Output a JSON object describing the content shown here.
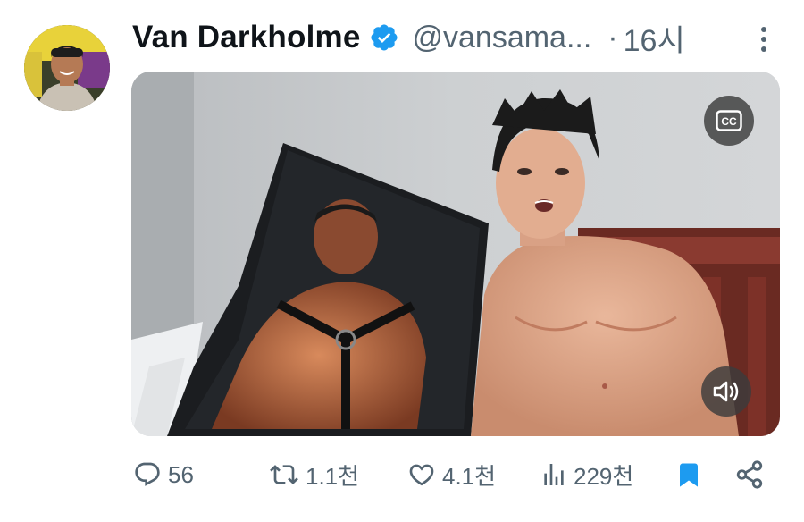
{
  "tweet": {
    "author": {
      "display_name": "Van Darkholme",
      "handle": "@vansama...",
      "verified": true,
      "avatar_icon": "profile-photo"
    },
    "separator": "·",
    "time": "16시",
    "menu_icon": "more-vertical-icon"
  },
  "media": {
    "type": "video",
    "captions_button": "CC",
    "volume_icon": "speaker-icon"
  },
  "actions": {
    "reply_count": "56",
    "retweet_count": "1.1천",
    "like_count": "4.1천",
    "view_count": "229천",
    "bookmark_icon": "bookmark-filled-icon",
    "share_icon": "share-icon"
  },
  "colors": {
    "verified_badge": "#1d9bf0",
    "bookmark_active": "#1d9bf0",
    "secondary_text": "#536471",
    "primary_text": "#0f1419"
  }
}
